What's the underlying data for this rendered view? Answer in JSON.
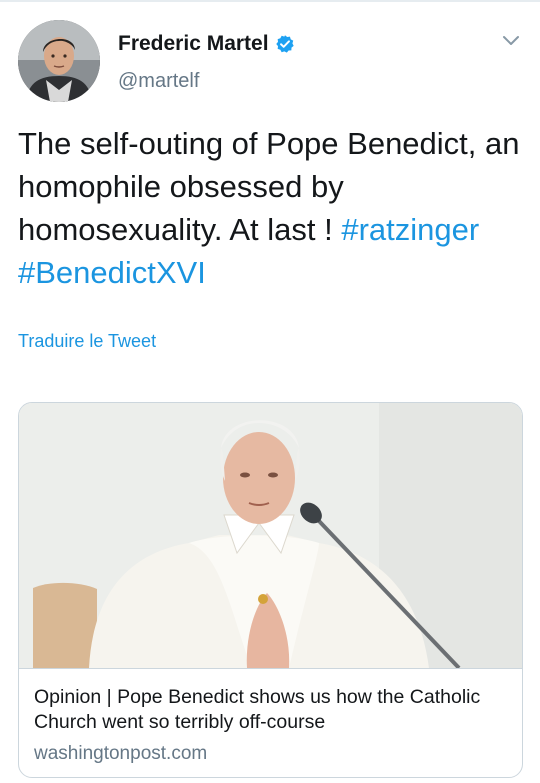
{
  "tweet": {
    "author": {
      "display_name": "Frederic Martel",
      "handle": "@martelf",
      "verified": true
    },
    "text_segments": [
      {
        "text": "The self-outing of Pope Benedict, an homophile obsessed by homosexuality. At last ! ",
        "type": "text"
      },
      {
        "text": "#ratzinger",
        "type": "hashtag"
      },
      {
        "text": " ",
        "type": "text"
      },
      {
        "text": "#BenedictXVI",
        "type": "hashtag"
      }
    ],
    "translate_label": "Traduire le Tweet",
    "card": {
      "title": "Opinion | Pope Benedict shows us how the Catholic Church went so terribly off-course",
      "domain": "washingtonpost.com"
    }
  },
  "icons": {
    "verified": "verified-badge-icon",
    "menu": "chevron-down-icon"
  },
  "colors": {
    "link": "#1b95e0",
    "text": "#14171a",
    "secondary": "#657786",
    "border": "#ccd6dd",
    "verified": "#1da1f2"
  }
}
